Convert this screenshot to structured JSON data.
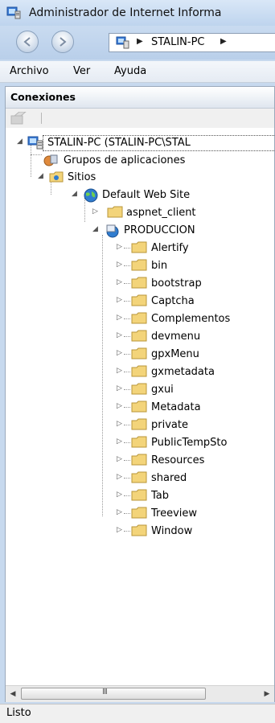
{
  "window": {
    "title": "Administrador de Internet Informa"
  },
  "address_bar": {
    "segments": [
      "STALIN-PC"
    ]
  },
  "menu": {
    "items": [
      "Archivo",
      "Ver",
      "Ayuda"
    ]
  },
  "connections_panel": {
    "title": "Conexiones"
  },
  "tree": {
    "server": "STALIN-PC (STALIN-PC\\STAL",
    "app_pools": "Grupos de aplicaciones",
    "sites": "Sitios",
    "default_site": "Default Web Site",
    "aspnet_client": "aspnet_client",
    "produccion": "PRODUCCION",
    "folders": [
      "Alertify",
      "bin",
      "bootstrap",
      "Captcha",
      "Complementos",
      "devmenu",
      "gpxMenu",
      "gxmetadata",
      "gxui",
      "Metadata",
      "private",
      "PublicTempSto",
      "Resources",
      "shared",
      "Tab",
      "Treeview",
      "Window"
    ]
  },
  "scrollbar": {
    "grip": "III"
  },
  "status": {
    "text": "Listo"
  },
  "colors": {
    "folder": "#f3d47a",
    "globe": "#2f7ccf",
    "chrome": "#c7d9ee"
  }
}
